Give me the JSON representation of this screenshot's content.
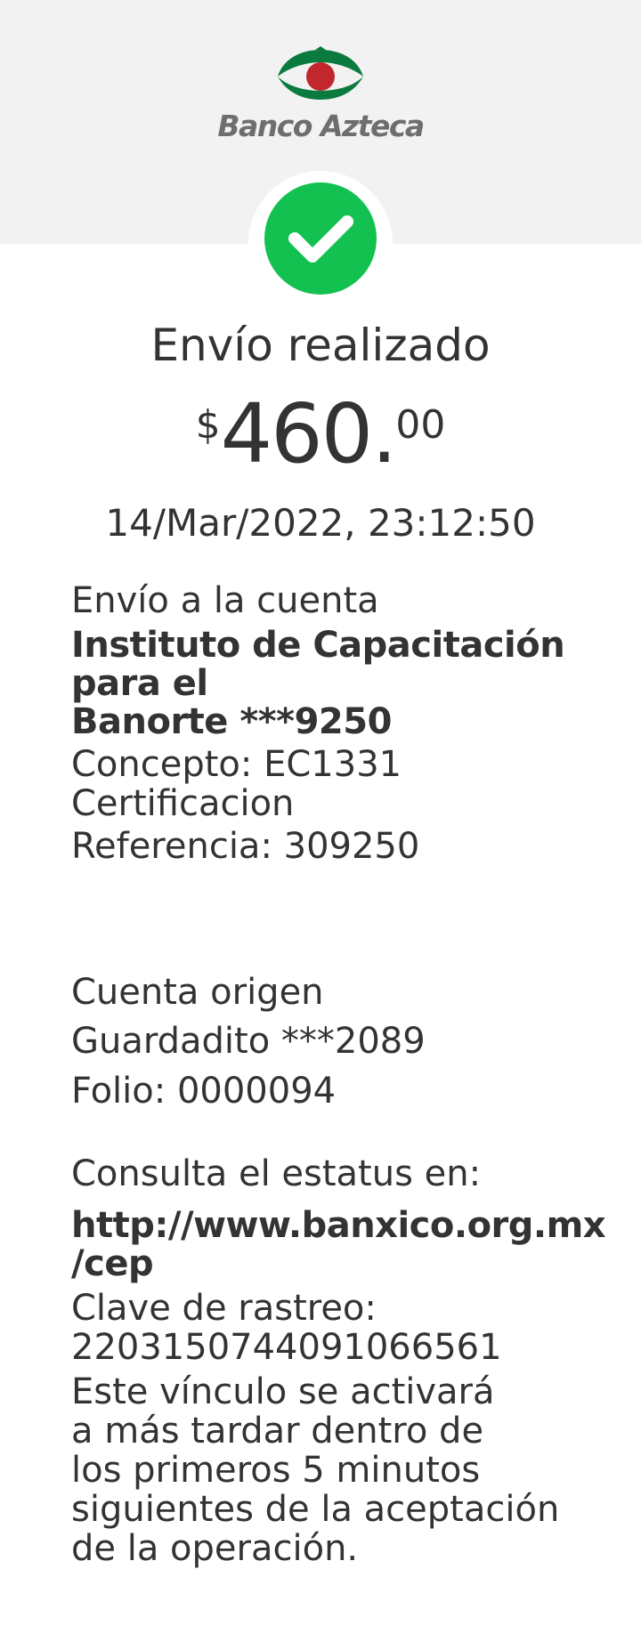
{
  "brand": {
    "name": "Banco Azteca",
    "green": "#0b7a3e",
    "red": "#c1272d"
  },
  "status": {
    "icon": "check-icon",
    "color": "#13c150",
    "title": "Envío realizado"
  },
  "amount": {
    "currency": "$",
    "integer": "460.",
    "cents": "00"
  },
  "datetime": "14/Mar/2022, 23:12:50",
  "destination": {
    "label": "Envío a la cuenta",
    "name_line1": "Instituto de Capacitación",
    "name_line2": "para  el",
    "bank_account": "Banorte ***9250",
    "concept_line1": "Concepto: EC1331",
    "concept_line2": "Certificacion",
    "reference": "Referencia: 309250"
  },
  "origin": {
    "label": "Cuenta origen",
    "account": "Guardadito  ***2089",
    "folio": "Folio: 0000094"
  },
  "status_check": {
    "label": "Consulta el estatus en:",
    "url_line1": "http://www.banxico.org.mx",
    "url_line2": "/cep",
    "tracking_label": "Clave de rastreo:",
    "tracking_value": "2203150744091066561",
    "note_line1": "Este vínculo se activará",
    "note_line2": "a más tardar dentro de",
    "note_line3": "los primeros 5 minutos",
    "note_line4": "siguientes de la aceptación",
    "note_line5": "de la operación."
  }
}
